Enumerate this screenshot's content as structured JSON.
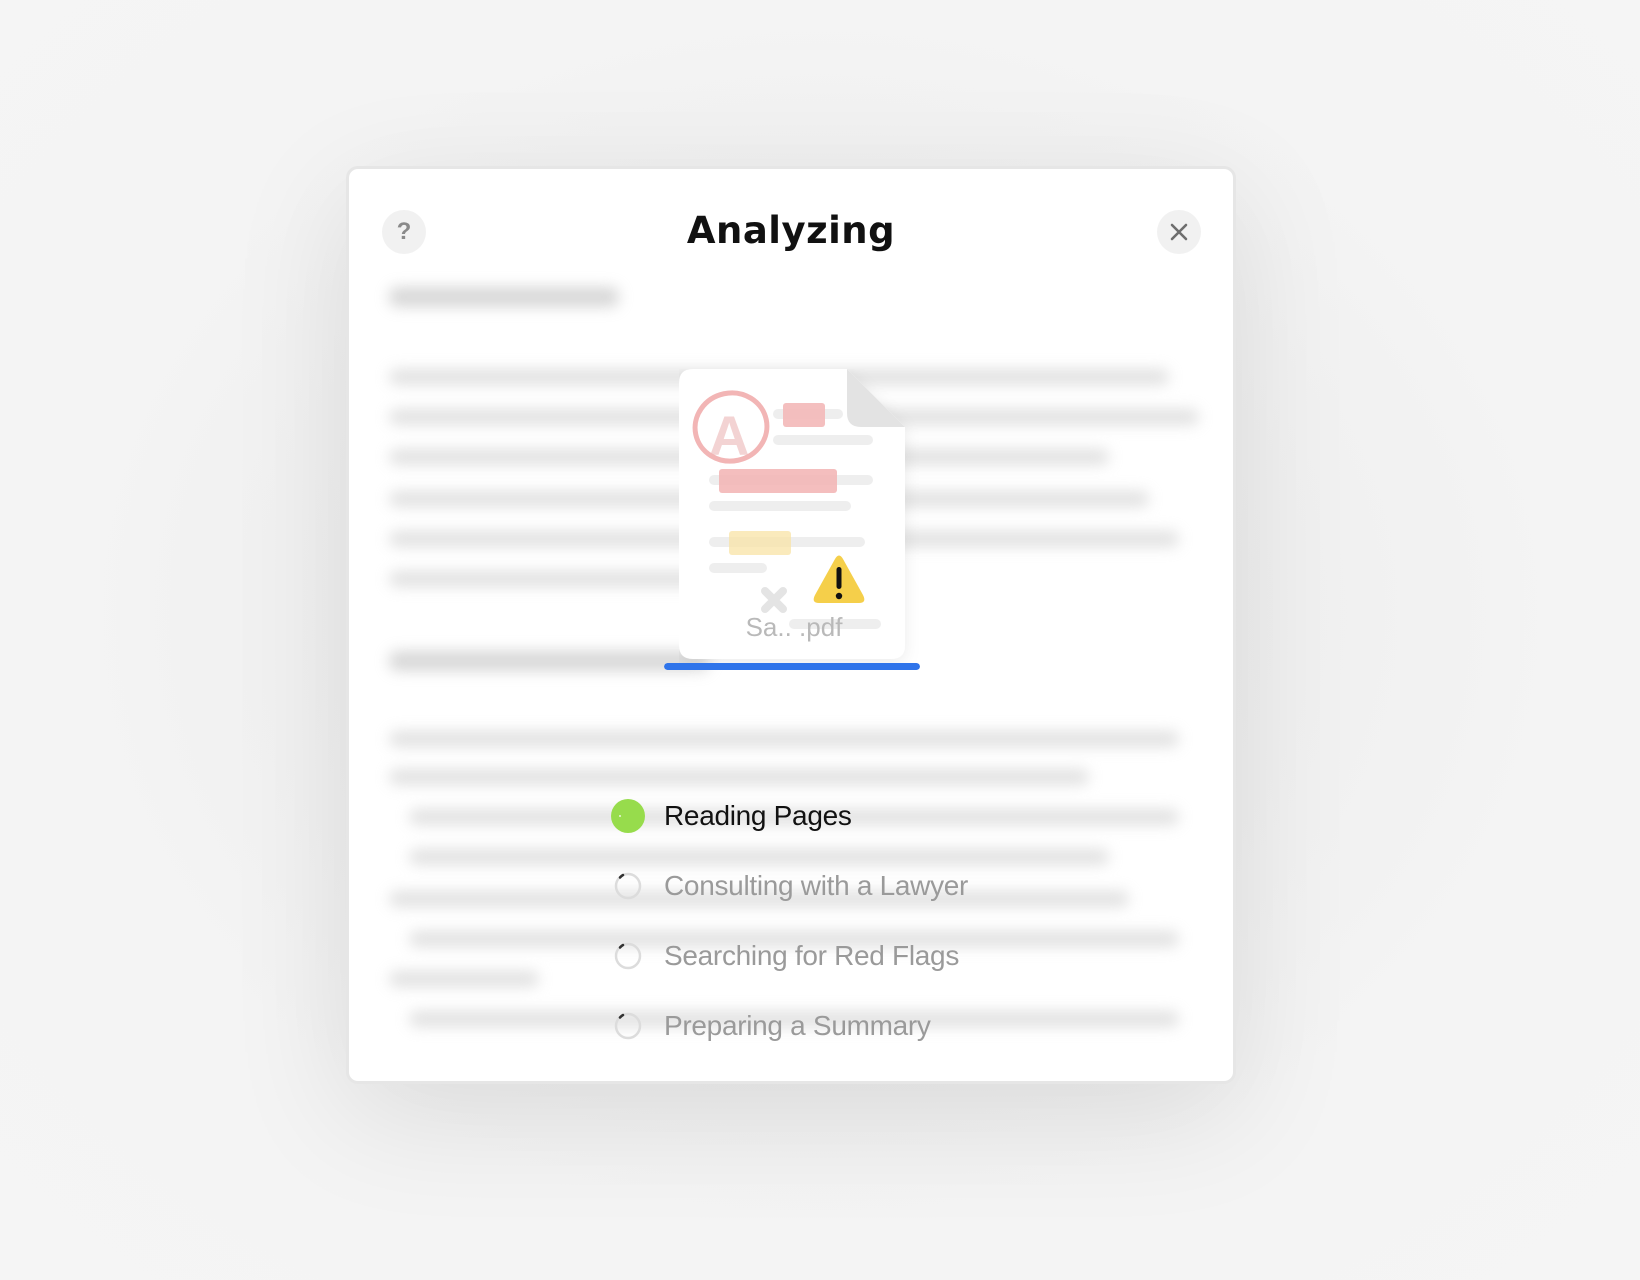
{
  "dialog": {
    "title": "Analyzing",
    "help_icon": "question-icon",
    "close_icon": "close-icon"
  },
  "document": {
    "filename": "Sa.. .pdf",
    "progress": 1.0,
    "accent_color": "#2f74ea",
    "warning_icon": "warning-icon"
  },
  "steps": [
    {
      "label": "Reading Pages",
      "status": "done",
      "color": "#97dc4c"
    },
    {
      "label": "Consulting with a Lawyer",
      "status": "pending"
    },
    {
      "label": "Searching for Red Flags",
      "status": "pending"
    },
    {
      "label": "Preparing a Summary",
      "status": "pending"
    }
  ]
}
